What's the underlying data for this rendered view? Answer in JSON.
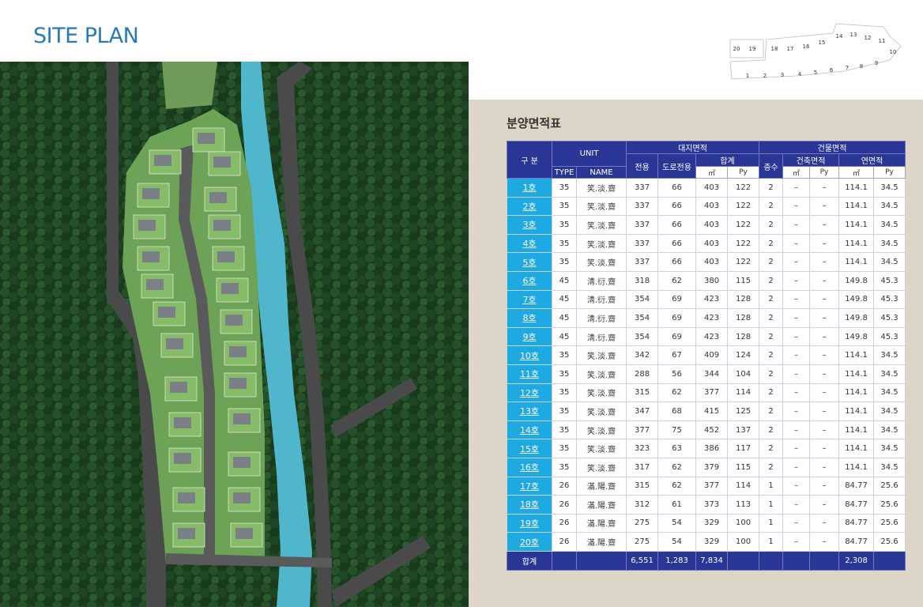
{
  "title": "SITE PLAN",
  "table_title": "분양면적표",
  "keymap_lots": [
    "20",
    "19",
    "18",
    "17",
    "16",
    "15",
    "14",
    "13",
    "12",
    "11",
    "10",
    "9",
    "8",
    "7",
    "6",
    "5",
    "4",
    "3",
    "2",
    "1"
  ],
  "headers": {
    "division": "구 분",
    "unit": "UNIT",
    "type": "TYPE",
    "name": "NAME",
    "land_area": "대지면적",
    "exclusive": "전용",
    "road": "도로전용",
    "total": "합계",
    "m2": "㎡",
    "py": "Py",
    "building_area": "건물면적",
    "floors": "층수",
    "building_coverage": "건축면적",
    "floor_area": "연면적"
  },
  "rows": [
    {
      "unit": "1호",
      "type": "35",
      "name": "笑.淡.齋",
      "excl": "337",
      "road": "66",
      "m2": "403",
      "py": "122",
      "floors": "2",
      "bm2": "–",
      "bpy": "–",
      "fm2": "114.1",
      "fpy": "34.5"
    },
    {
      "unit": "2호",
      "type": "35",
      "name": "笑.淡.齋",
      "excl": "337",
      "road": "66",
      "m2": "403",
      "py": "122",
      "floors": "2",
      "bm2": "–",
      "bpy": "–",
      "fm2": "114.1",
      "fpy": "34.5"
    },
    {
      "unit": "3호",
      "type": "35",
      "name": "笑.淡.齋",
      "excl": "337",
      "road": "66",
      "m2": "403",
      "py": "122",
      "floors": "2",
      "bm2": "–",
      "bpy": "–",
      "fm2": "114.1",
      "fpy": "34.5"
    },
    {
      "unit": "4호",
      "type": "35",
      "name": "笑.淡.齋",
      "excl": "337",
      "road": "66",
      "m2": "403",
      "py": "122",
      "floors": "2",
      "bm2": "–",
      "bpy": "–",
      "fm2": "114.1",
      "fpy": "34.5"
    },
    {
      "unit": "5호",
      "type": "35",
      "name": "笑.淡.齋",
      "excl": "337",
      "road": "66",
      "m2": "403",
      "py": "122",
      "floors": "2",
      "bm2": "–",
      "bpy": "–",
      "fm2": "114.1",
      "fpy": "34.5"
    },
    {
      "unit": "6호",
      "type": "45",
      "name": "淸.衍.齋",
      "excl": "318",
      "road": "62",
      "m2": "380",
      "py": "115",
      "floors": "2",
      "bm2": "–",
      "bpy": "–",
      "fm2": "149.8",
      "fpy": "45.3"
    },
    {
      "unit": "7호",
      "type": "45",
      "name": "淸.衍.齋",
      "excl": "354",
      "road": "69",
      "m2": "423",
      "py": "128",
      "floors": "2",
      "bm2": "–",
      "bpy": "–",
      "fm2": "149.8",
      "fpy": "45.3"
    },
    {
      "unit": "8호",
      "type": "45",
      "name": "淸.衍.齋",
      "excl": "354",
      "road": "69",
      "m2": "423",
      "py": "128",
      "floors": "2",
      "bm2": "–",
      "bpy": "–",
      "fm2": "149.8",
      "fpy": "45.3"
    },
    {
      "unit": "9호",
      "type": "45",
      "name": "淸.衍.齋",
      "excl": "354",
      "road": "69",
      "m2": "423",
      "py": "128",
      "floors": "2",
      "bm2": "–",
      "bpy": "–",
      "fm2": "149.8",
      "fpy": "45.3"
    },
    {
      "unit": "10호",
      "type": "35",
      "name": "笑.淡.齋",
      "excl": "342",
      "road": "67",
      "m2": "409",
      "py": "124",
      "floors": "2",
      "bm2": "–",
      "bpy": "–",
      "fm2": "114.1",
      "fpy": "34.5"
    },
    {
      "unit": "11호",
      "type": "35",
      "name": "笑.淡.齋",
      "excl": "288",
      "road": "56",
      "m2": "344",
      "py": "104",
      "floors": "2",
      "bm2": "–",
      "bpy": "–",
      "fm2": "114.1",
      "fpy": "34.5"
    },
    {
      "unit": "12호",
      "type": "35",
      "name": "笑.淡.齋",
      "excl": "315",
      "road": "62",
      "m2": "377",
      "py": "114",
      "floors": "2",
      "bm2": "–",
      "bpy": "–",
      "fm2": "114.1",
      "fpy": "34.5"
    },
    {
      "unit": "13호",
      "type": "35",
      "name": "笑.淡.齋",
      "excl": "347",
      "road": "68",
      "m2": "415",
      "py": "125",
      "floors": "2",
      "bm2": "–",
      "bpy": "–",
      "fm2": "114.1",
      "fpy": "34.5"
    },
    {
      "unit": "14호",
      "type": "35",
      "name": "笑.淡.齋",
      "excl": "377",
      "road": "75",
      "m2": "452",
      "py": "137",
      "floors": "2",
      "bm2": "–",
      "bpy": "–",
      "fm2": "114.1",
      "fpy": "34.5"
    },
    {
      "unit": "15호",
      "type": "35",
      "name": "笑.淡.齋",
      "excl": "323",
      "road": "63",
      "m2": "386",
      "py": "117",
      "floors": "2",
      "bm2": "–",
      "bpy": "–",
      "fm2": "114.1",
      "fpy": "34.5"
    },
    {
      "unit": "16호",
      "type": "35",
      "name": "笑.淡.齋",
      "excl": "317",
      "road": "62",
      "m2": "379",
      "py": "115",
      "floors": "2",
      "bm2": "–",
      "bpy": "–",
      "fm2": "114.1",
      "fpy": "34.5"
    },
    {
      "unit": "17호",
      "type": "26",
      "name": "滿.陽.齋",
      "excl": "315",
      "road": "62",
      "m2": "377",
      "py": "114",
      "floors": "1",
      "bm2": "–",
      "bpy": "–",
      "fm2": "84.77",
      "fpy": "25.6"
    },
    {
      "unit": "18호",
      "type": "26",
      "name": "滿.陽.齋",
      "excl": "312",
      "road": "61",
      "m2": "373",
      "py": "113",
      "floors": "1",
      "bm2": "–",
      "bpy": "–",
      "fm2": "84.77",
      "fpy": "25.6"
    },
    {
      "unit": "19호",
      "type": "26",
      "name": "滿.陽.齋",
      "excl": "275",
      "road": "54",
      "m2": "329",
      "py": "100",
      "floors": "1",
      "bm2": "–",
      "bpy": "–",
      "fm2": "84.77",
      "fpy": "25.6"
    },
    {
      "unit": "20호",
      "type": "26",
      "name": "滿.陽.齋",
      "excl": "275",
      "road": "54",
      "m2": "329",
      "py": "100",
      "floors": "1",
      "bm2": "–",
      "bpy": "–",
      "fm2": "84.77",
      "fpy": "25.6"
    }
  ],
  "totals": {
    "label": "합계",
    "excl": "6,551",
    "road": "1,283",
    "m2": "7,834",
    "fm2": "2,308"
  },
  "colors": {
    "title": "#2a7ab8",
    "header": "#2a3696",
    "unit_cell": "#1ea9e3",
    "panel": "#ddd5c7",
    "river": "#4fb6cc",
    "forest": "#1d3f1f"
  }
}
